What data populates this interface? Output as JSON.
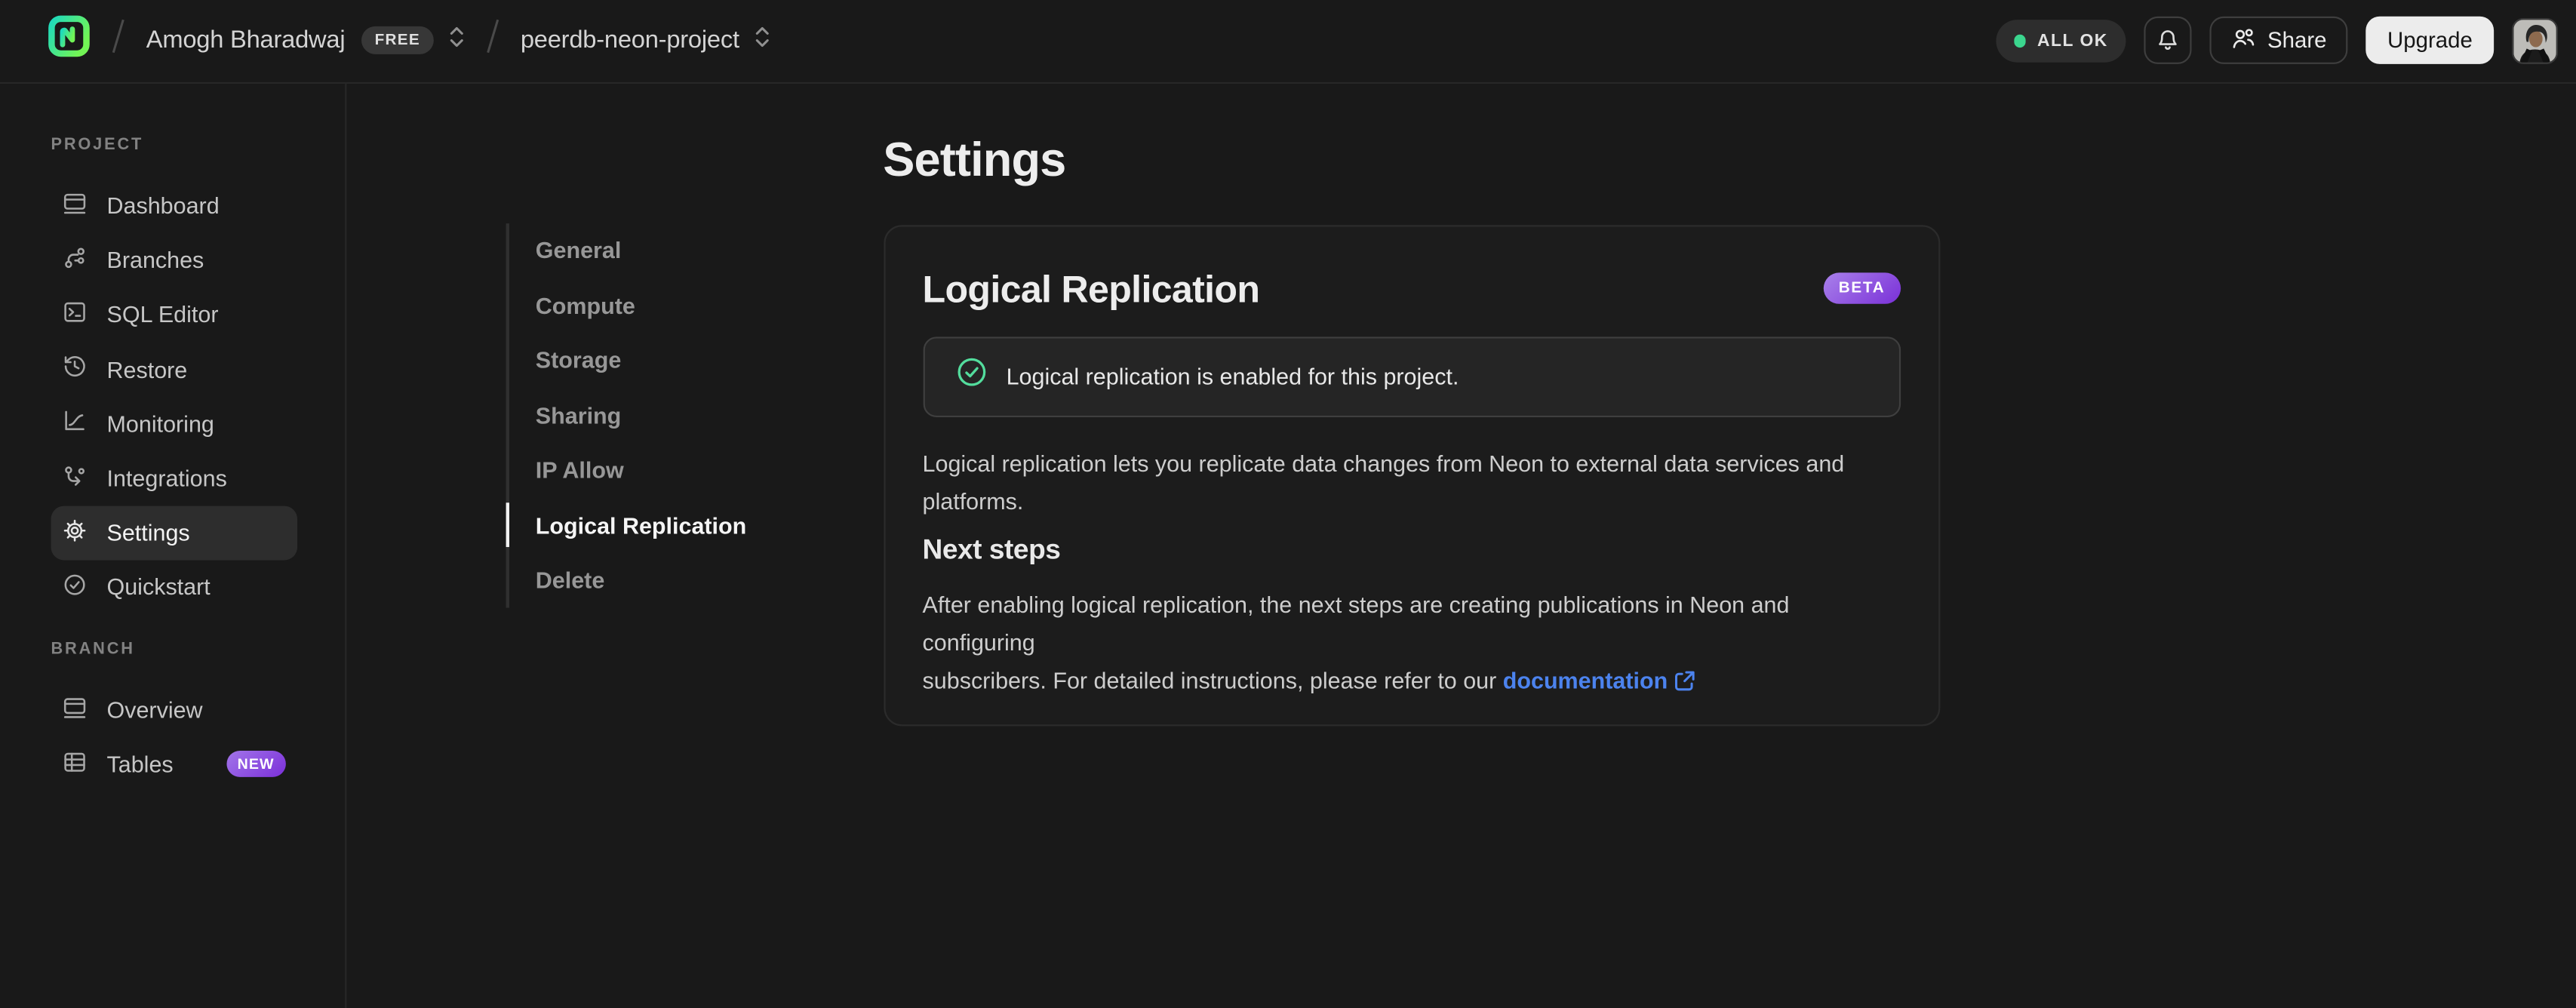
{
  "topbar": {
    "org_name": "Amogh Bharadwaj",
    "org_plan_badge": "FREE",
    "project_name": "peerdb-neon-project",
    "status_pill": "ALL OK",
    "share_label": "Share",
    "upgrade_label": "Upgrade"
  },
  "sidebar": {
    "sections": [
      {
        "label": "PROJECT",
        "items": [
          {
            "label": "Dashboard",
            "icon": "window-icon"
          },
          {
            "label": "Branches",
            "icon": "branches-icon"
          },
          {
            "label": "SQL Editor",
            "icon": "terminal-icon"
          },
          {
            "label": "Restore",
            "icon": "history-icon"
          },
          {
            "label": "Monitoring",
            "icon": "chart-icon"
          },
          {
            "label": "Integrations",
            "icon": "integrations-icon"
          },
          {
            "label": "Settings",
            "icon": "gear-icon",
            "active": true
          },
          {
            "label": "Quickstart",
            "icon": "check-circle-icon"
          }
        ]
      },
      {
        "label": "BRANCH",
        "items": [
          {
            "label": "Overview",
            "icon": "window-icon"
          },
          {
            "label": "Tables",
            "icon": "table-icon",
            "badge": "NEW"
          }
        ]
      }
    ]
  },
  "settings_nav": {
    "items": [
      {
        "label": "General"
      },
      {
        "label": "Compute"
      },
      {
        "label": "Storage"
      },
      {
        "label": "Sharing"
      },
      {
        "label": "IP Allow"
      },
      {
        "label": "Logical Replication",
        "active": true
      },
      {
        "label": "Delete"
      }
    ]
  },
  "main": {
    "page_title": "Settings",
    "card": {
      "title": "Logical Replication",
      "beta_badge": "BETA",
      "alert_text": "Logical replication is enabled for this project.",
      "description": "Logical replication lets you replicate data changes from Neon to external data services and\nplatforms.",
      "next_steps_title": "Next steps",
      "next_steps_text": "After enabling logical replication, the next steps are creating publications in Neon and configuring\nsubscribers. For detailed instructions, please refer to our ",
      "doc_link_label": "documentation"
    }
  },
  "colors": {
    "background": "#191919",
    "card_background": "#1c1c1c",
    "alert_background": "#252525",
    "accent_green": "#53dd9d",
    "status_dot_green": "#3bd68e",
    "link_blue": "#4c83ee",
    "badge_purple_start": "#a981ea",
    "badge_purple_end": "#7a30d8",
    "logo_teal": "#1edabd",
    "logo_green": "#72f455"
  }
}
